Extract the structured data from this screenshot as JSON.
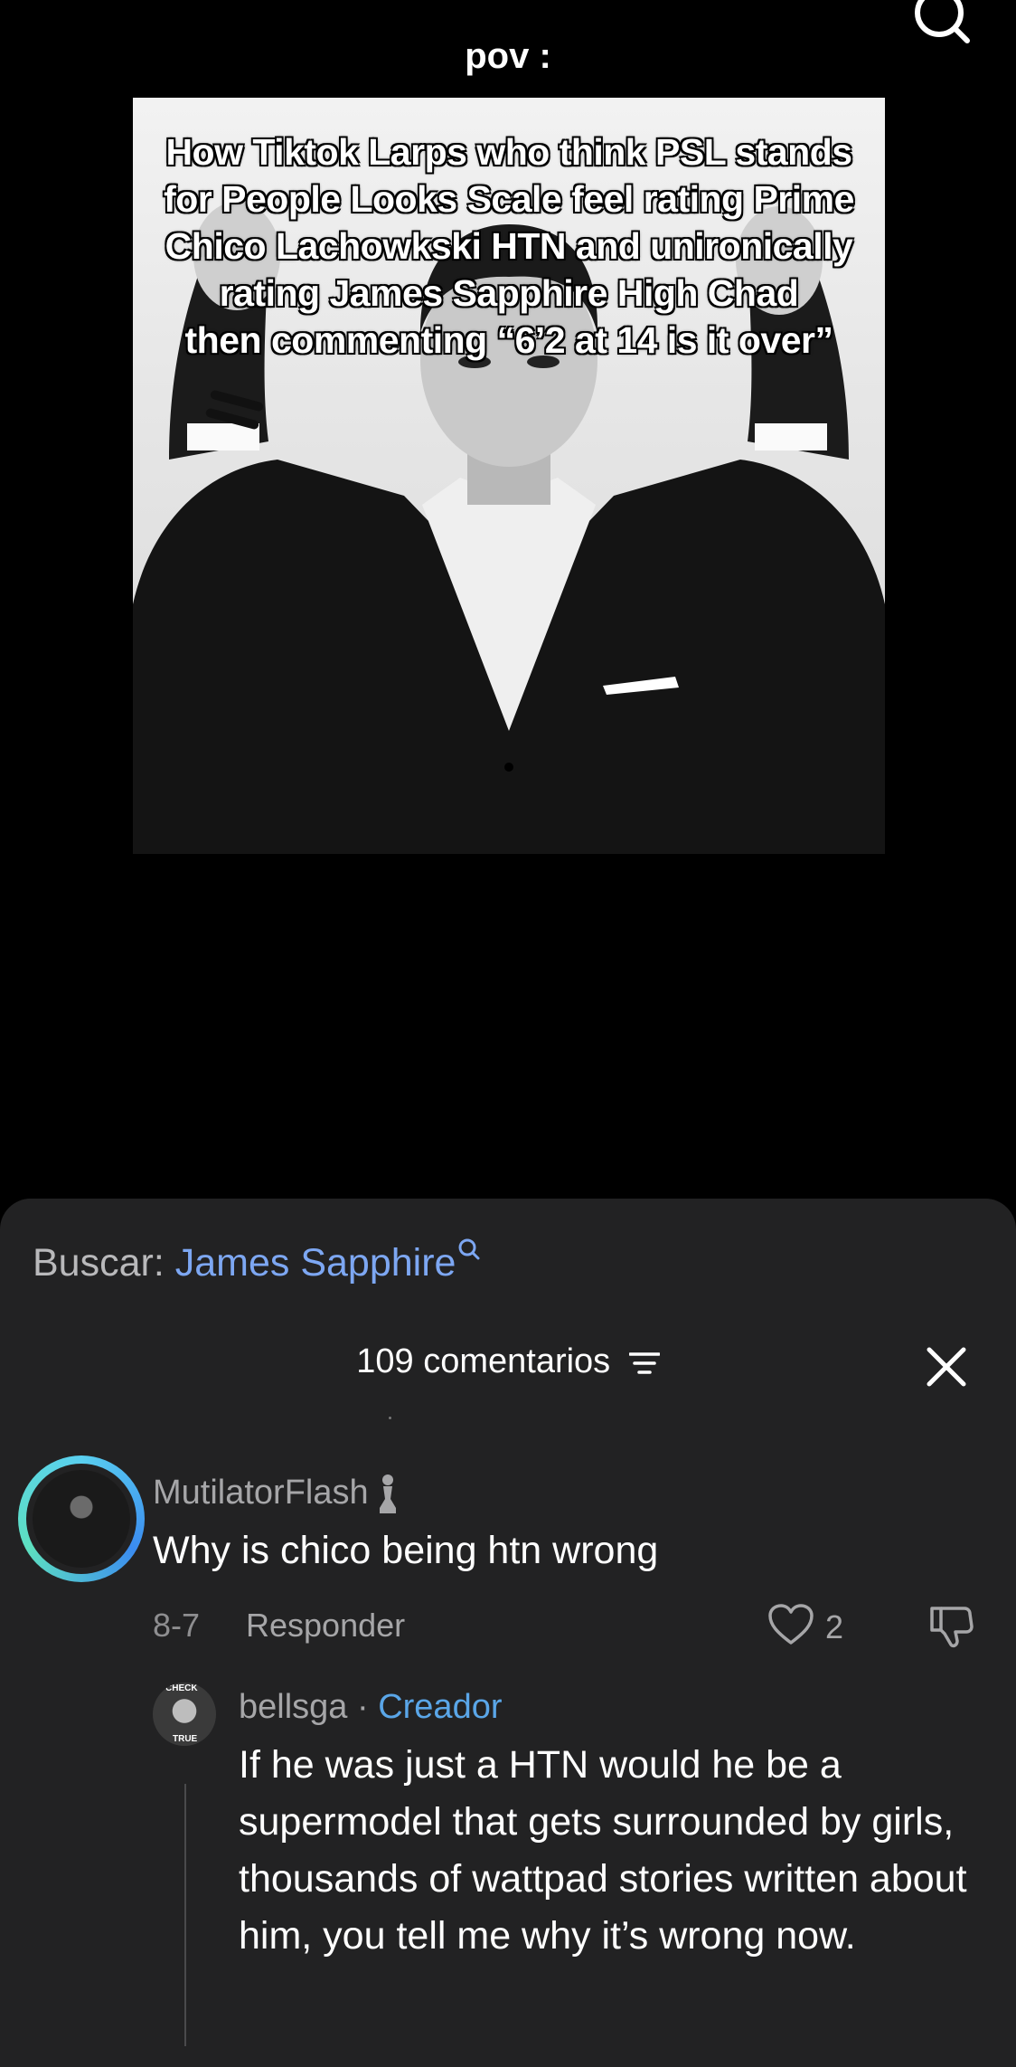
{
  "video": {
    "caption": "pov :",
    "overlay_lines": [
      "How Tiktok Larps who think PSL stands",
      "for People Looks Scale feel rating Prime",
      "Chico Lachowkski HTN and unironically",
      "rating James Sapphire High Chad",
      "then commenting “6’2 at 14 is it over”"
    ]
  },
  "search": {
    "label": "Buscar:",
    "query": "James Sapphire"
  },
  "comments": {
    "count_label": "109 comentarios"
  },
  "comment": {
    "username": "MutilatorFlash",
    "text": "Why is chico being htn wrong",
    "date": "8-7",
    "reply_label": "Responder",
    "likes": "2"
  },
  "reply": {
    "username": "bellsga",
    "separator": "·",
    "badge": "Creador",
    "text": "If he was just a HTN would he be a supermodel that gets surrounded by girls, thousands of wattpad stories written about him, you tell me why it’s wrong now.",
    "avatar_top_text": "CHECK",
    "avatar_bottom_text": "TRUE"
  },
  "colors": {
    "sheet_bg": "#222223",
    "link_blue": "#7da7f2",
    "creator_blue": "#5aa6e8"
  }
}
